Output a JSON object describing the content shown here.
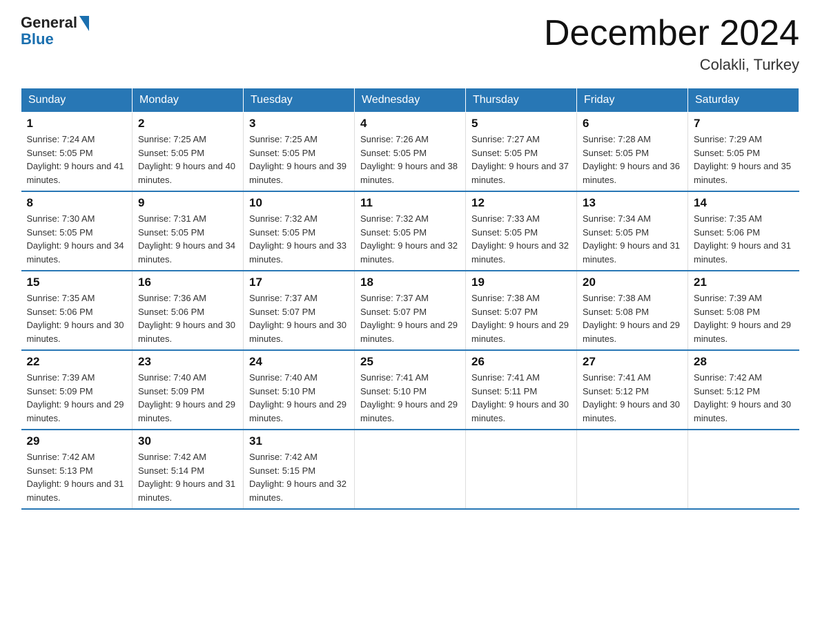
{
  "logo": {
    "general": "General",
    "blue": "Blue"
  },
  "title": "December 2024",
  "location": "Colakli, Turkey",
  "days_of_week": [
    "Sunday",
    "Monday",
    "Tuesday",
    "Wednesday",
    "Thursday",
    "Friday",
    "Saturday"
  ],
  "weeks": [
    [
      {
        "day": "1",
        "sunrise": "7:24 AM",
        "sunset": "5:05 PM",
        "daylight": "9 hours and 41 minutes."
      },
      {
        "day": "2",
        "sunrise": "7:25 AM",
        "sunset": "5:05 PM",
        "daylight": "9 hours and 40 minutes."
      },
      {
        "day": "3",
        "sunrise": "7:25 AM",
        "sunset": "5:05 PM",
        "daylight": "9 hours and 39 minutes."
      },
      {
        "day": "4",
        "sunrise": "7:26 AM",
        "sunset": "5:05 PM",
        "daylight": "9 hours and 38 minutes."
      },
      {
        "day": "5",
        "sunrise": "7:27 AM",
        "sunset": "5:05 PM",
        "daylight": "9 hours and 37 minutes."
      },
      {
        "day": "6",
        "sunrise": "7:28 AM",
        "sunset": "5:05 PM",
        "daylight": "9 hours and 36 minutes."
      },
      {
        "day": "7",
        "sunrise": "7:29 AM",
        "sunset": "5:05 PM",
        "daylight": "9 hours and 35 minutes."
      }
    ],
    [
      {
        "day": "8",
        "sunrise": "7:30 AM",
        "sunset": "5:05 PM",
        "daylight": "9 hours and 34 minutes."
      },
      {
        "day": "9",
        "sunrise": "7:31 AM",
        "sunset": "5:05 PM",
        "daylight": "9 hours and 34 minutes."
      },
      {
        "day": "10",
        "sunrise": "7:32 AM",
        "sunset": "5:05 PM",
        "daylight": "9 hours and 33 minutes."
      },
      {
        "day": "11",
        "sunrise": "7:32 AM",
        "sunset": "5:05 PM",
        "daylight": "9 hours and 32 minutes."
      },
      {
        "day": "12",
        "sunrise": "7:33 AM",
        "sunset": "5:05 PM",
        "daylight": "9 hours and 32 minutes."
      },
      {
        "day": "13",
        "sunrise": "7:34 AM",
        "sunset": "5:05 PM",
        "daylight": "9 hours and 31 minutes."
      },
      {
        "day": "14",
        "sunrise": "7:35 AM",
        "sunset": "5:06 PM",
        "daylight": "9 hours and 31 minutes."
      }
    ],
    [
      {
        "day": "15",
        "sunrise": "7:35 AM",
        "sunset": "5:06 PM",
        "daylight": "9 hours and 30 minutes."
      },
      {
        "day": "16",
        "sunrise": "7:36 AM",
        "sunset": "5:06 PM",
        "daylight": "9 hours and 30 minutes."
      },
      {
        "day": "17",
        "sunrise": "7:37 AM",
        "sunset": "5:07 PM",
        "daylight": "9 hours and 30 minutes."
      },
      {
        "day": "18",
        "sunrise": "7:37 AM",
        "sunset": "5:07 PM",
        "daylight": "9 hours and 29 minutes."
      },
      {
        "day": "19",
        "sunrise": "7:38 AM",
        "sunset": "5:07 PM",
        "daylight": "9 hours and 29 minutes."
      },
      {
        "day": "20",
        "sunrise": "7:38 AM",
        "sunset": "5:08 PM",
        "daylight": "9 hours and 29 minutes."
      },
      {
        "day": "21",
        "sunrise": "7:39 AM",
        "sunset": "5:08 PM",
        "daylight": "9 hours and 29 minutes."
      }
    ],
    [
      {
        "day": "22",
        "sunrise": "7:39 AM",
        "sunset": "5:09 PM",
        "daylight": "9 hours and 29 minutes."
      },
      {
        "day": "23",
        "sunrise": "7:40 AM",
        "sunset": "5:09 PM",
        "daylight": "9 hours and 29 minutes."
      },
      {
        "day": "24",
        "sunrise": "7:40 AM",
        "sunset": "5:10 PM",
        "daylight": "9 hours and 29 minutes."
      },
      {
        "day": "25",
        "sunrise": "7:41 AM",
        "sunset": "5:10 PM",
        "daylight": "9 hours and 29 minutes."
      },
      {
        "day": "26",
        "sunrise": "7:41 AM",
        "sunset": "5:11 PM",
        "daylight": "9 hours and 30 minutes."
      },
      {
        "day": "27",
        "sunrise": "7:41 AM",
        "sunset": "5:12 PM",
        "daylight": "9 hours and 30 minutes."
      },
      {
        "day": "28",
        "sunrise": "7:42 AM",
        "sunset": "5:12 PM",
        "daylight": "9 hours and 30 minutes."
      }
    ],
    [
      {
        "day": "29",
        "sunrise": "7:42 AM",
        "sunset": "5:13 PM",
        "daylight": "9 hours and 31 minutes."
      },
      {
        "day": "30",
        "sunrise": "7:42 AM",
        "sunset": "5:14 PM",
        "daylight": "9 hours and 31 minutes."
      },
      {
        "day": "31",
        "sunrise": "7:42 AM",
        "sunset": "5:15 PM",
        "daylight": "9 hours and 32 minutes."
      },
      null,
      null,
      null,
      null
    ]
  ]
}
